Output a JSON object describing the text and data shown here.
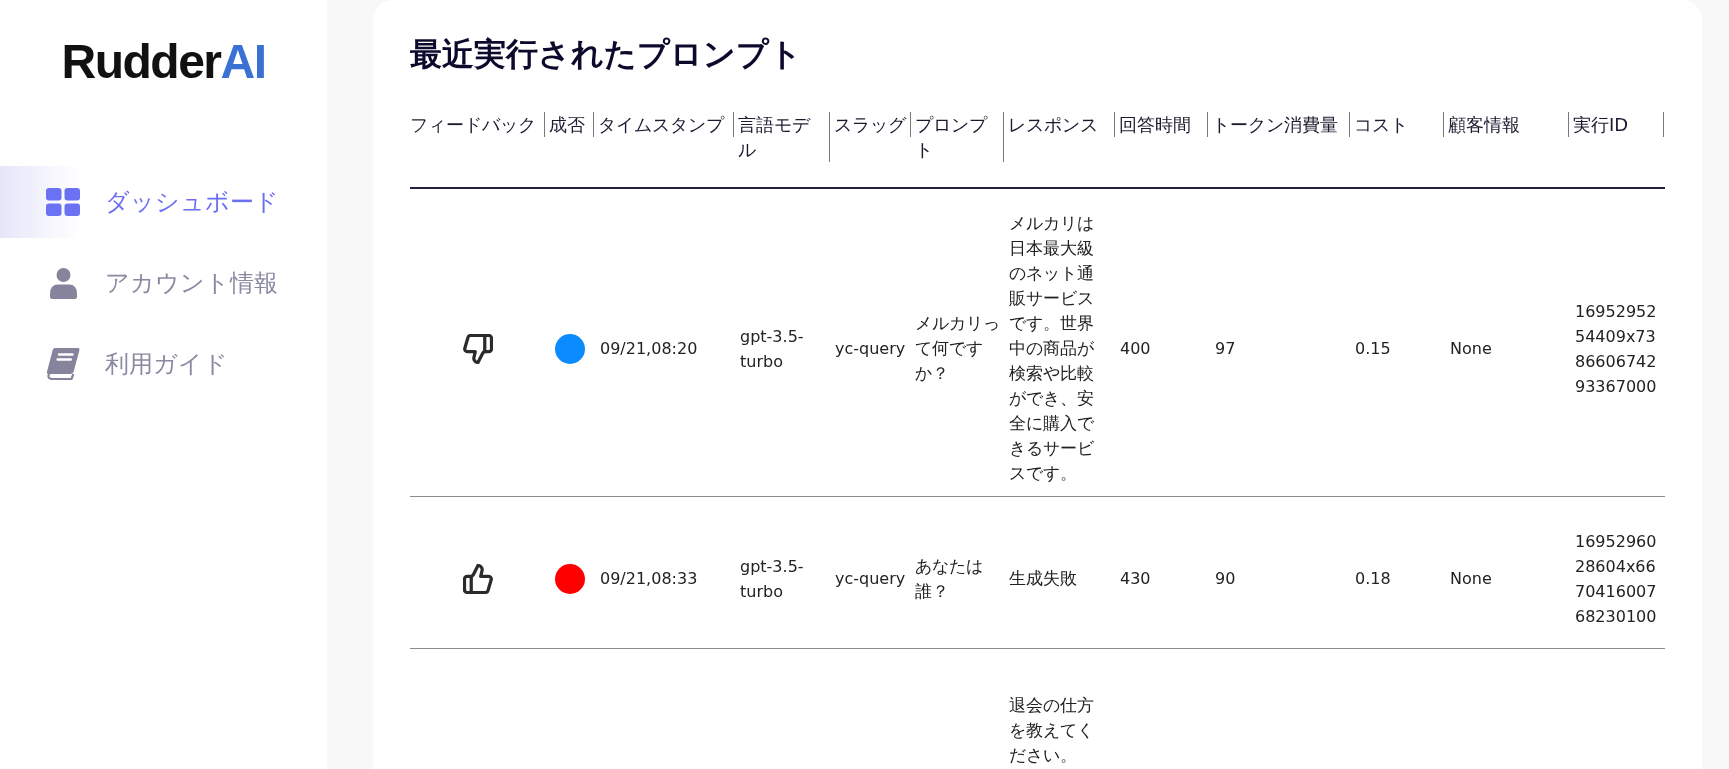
{
  "sidebar": {
    "logo": {
      "text": "Rudder",
      "accent": "AI"
    },
    "items": [
      {
        "label": "ダッシュボード",
        "selected": true
      },
      {
        "label": "アカウント情報",
        "selected": false
      },
      {
        "label": "利用ガイド",
        "selected": false
      }
    ]
  },
  "main": {
    "title": "最近実行されたプロンプト"
  },
  "table": {
    "columns": [
      "フィードバック",
      "成否",
      "タイムスタンプ",
      "言語モデル",
      "スラッグ",
      "プロンプト",
      "レスポンス",
      "回答時間",
      "トークン消費量",
      "コスト",
      "顧客情報",
      "実行ID"
    ],
    "rows": [
      {
        "liked": false,
        "color": "#0a8cff",
        "timestamp": "09/21,08:20",
        "model": "gpt-3.5-turbo",
        "slug": "yc-query",
        "prompt": "メルカリって何ですか？",
        "response": "メルカリは日本最大級のネット通販サービスです。世界中の商品が検索や比較ができ、安全に購入できるサービスです。",
        "response_time": "400",
        "tokens": "97",
        "cost": "0.15",
        "customer": "None",
        "run_id": "1695295254409x738660674293367000"
      },
      {
        "liked": true,
        "color": "#ff0000",
        "timestamp": "09/21,08:33",
        "model": "gpt-3.5-turbo",
        "slug": "yc-query",
        "prompt": "あなたは誰？",
        "response": "生成失敗",
        "response_time": "430",
        "tokens": "90",
        "cost": "0.18",
        "customer": "None",
        "run_id": "1695296028604x667041600768230100"
      },
      {
        "response": "退会の仕方を教えてください。"
      }
    ]
  }
}
